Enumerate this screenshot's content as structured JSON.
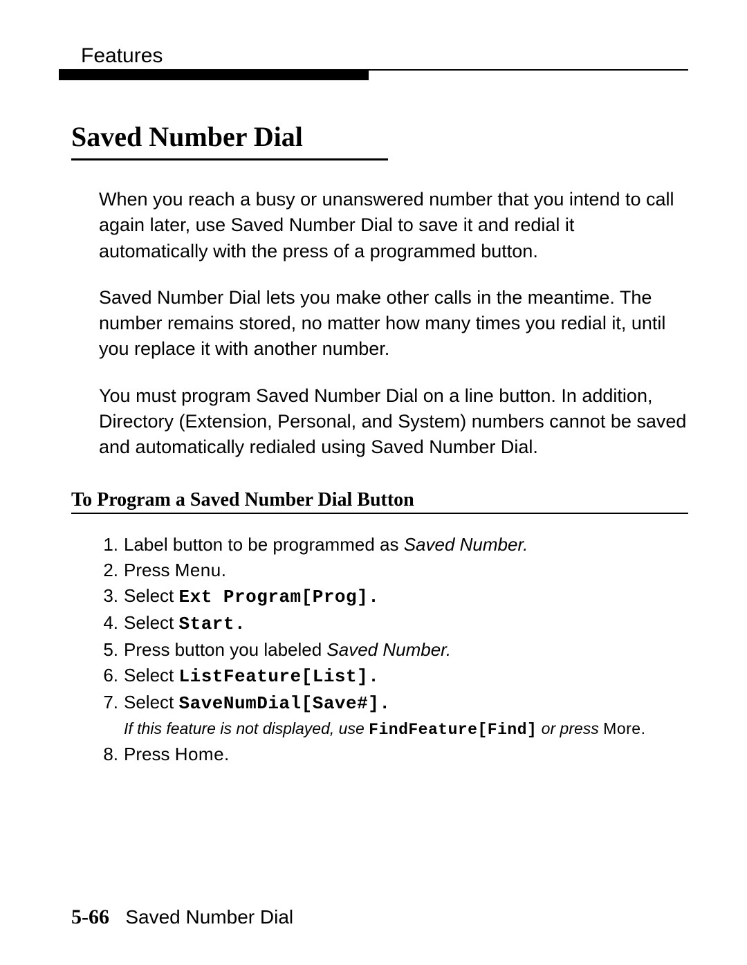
{
  "header": {
    "label": "Features"
  },
  "title": "Saved Number Dial",
  "paragraphs": {
    "p1": "When you reach a busy or unanswered number that you intend to call again later, use Saved Number Dial to save it and redial it automatically with the press of a programmed button.",
    "p2": "Saved Number Dial lets you make other calls in the meantime. The number remains stored, no matter how many times you redial it, until you replace it with another number.",
    "p3": "You must program Saved Number Dial on a line button. In addition, Directory (Extension, Personal, and System) numbers cannot be saved and automatically redialed using Saved Number Dial."
  },
  "subheading": "To Program a Saved Number Dial Button",
  "steps": {
    "s1_a": "Label button to be programmed as ",
    "s1_b": "Saved Number.",
    "s2_a": "Press ",
    "s2_b": "Menu.",
    "s3_a": "Select ",
    "s3_b": "Ext Program[Prog].",
    "s4_a": "Select ",
    "s4_b": "Start.",
    "s5_a": "Press button you labeled ",
    "s5_b": "Saved Number.",
    "s6_a": "Select ",
    "s6_b": "ListFeature[List].",
    "s7_a": "Select ",
    "s7_b": "SaveNumDial[Save#].",
    "s7_sub_a": "If this feature is not displayed, use ",
    "s7_sub_b": "FindFeature[Find]",
    "s7_sub_c": " or press ",
    "s7_sub_d": "More.",
    "s8_a": "Press ",
    "s8_b": "Home."
  },
  "nums": {
    "n1": "1.",
    "n2": "2.",
    "n3": "3.",
    "n4": "4.",
    "n5": "5.",
    "n6": "6.",
    "n7": "7.",
    "n8": "8."
  },
  "footer": {
    "page": "5-66",
    "label": "Saved Number Dial"
  }
}
